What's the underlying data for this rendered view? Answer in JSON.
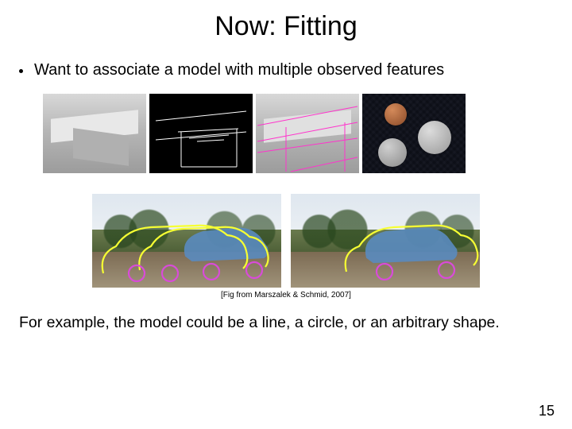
{
  "title": "Now: Fitting",
  "bullet": "Want to associate a model with multiple observed features",
  "caption": "[Fig from Marszalek & Schmid, 2007]",
  "conclusion": "For example, the model could be a line, a circle, or an arbitrary shape.",
  "page_number": "15"
}
